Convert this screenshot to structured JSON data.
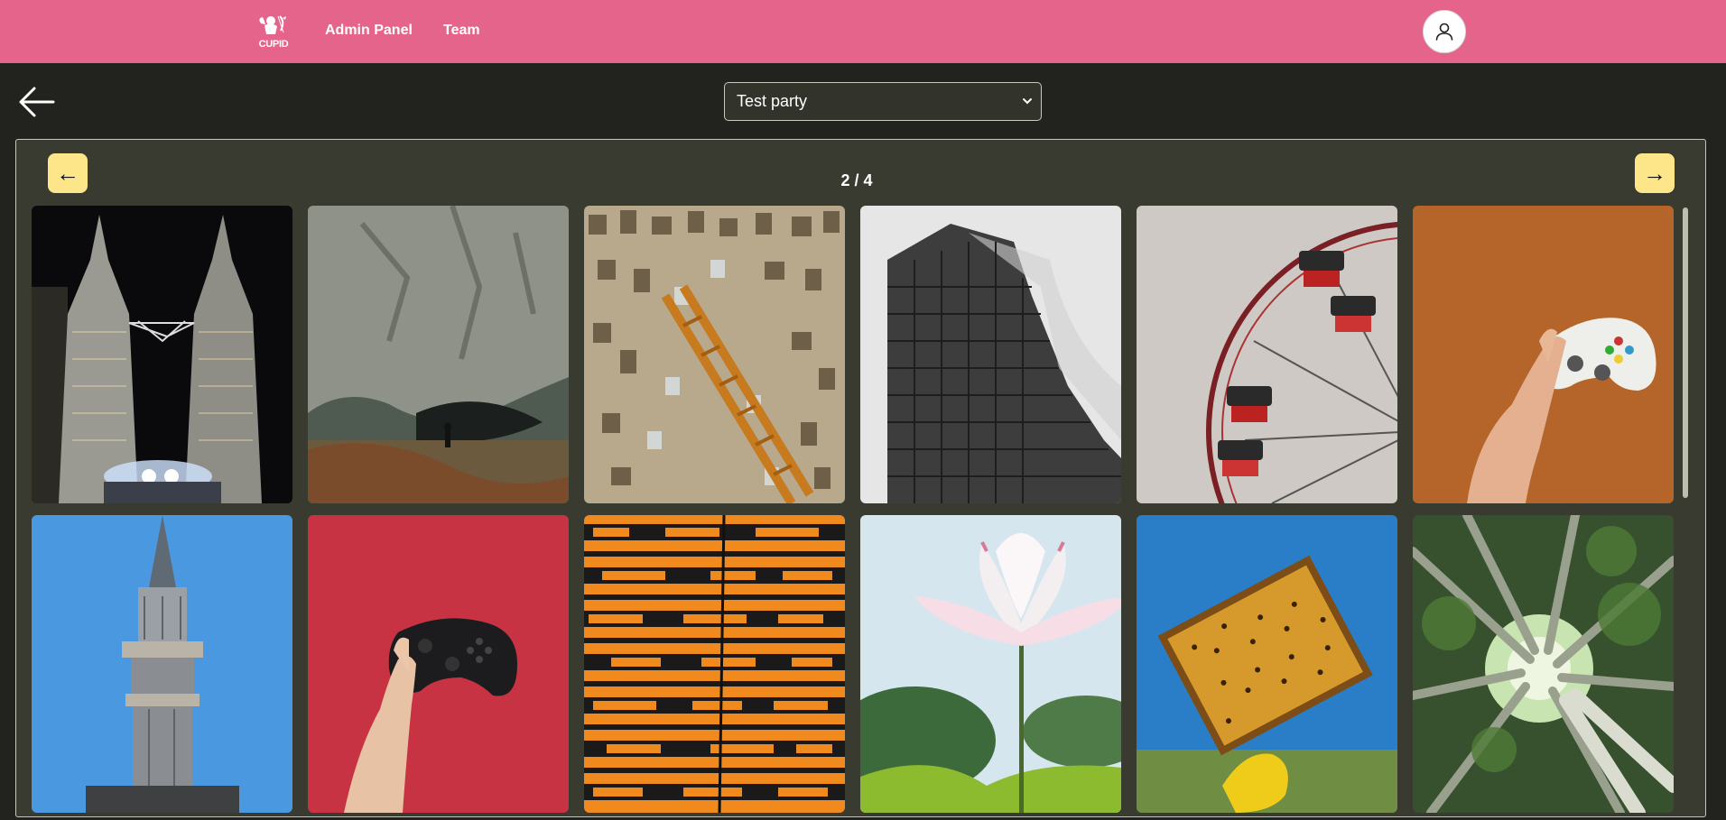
{
  "header": {
    "logo_text": "CUPID",
    "nav": [
      {
        "label": "Admin Panel"
      },
      {
        "label": "Team"
      }
    ],
    "icons": {
      "logo": "cupid-logo-icon",
      "avatar": "user-icon"
    },
    "colors": {
      "bar": "#e5648c"
    }
  },
  "toolbar": {
    "back_icon": "arrow-left-icon",
    "party_select": {
      "selected": "Test party"
    }
  },
  "gallery": {
    "page_label": "2 / 4",
    "prev_label": "←",
    "next_label": "→",
    "colors": {
      "pager_button": "#fde68a",
      "panel": "#393b30"
    },
    "images": [
      {
        "subject": "twin-towers-night"
      },
      {
        "subject": "cave-cliff"
      },
      {
        "subject": "book-wall-staircase"
      },
      {
        "subject": "grey-skyscraper"
      },
      {
        "subject": "ferris-wheel"
      },
      {
        "subject": "hand-white-gamepad"
      },
      {
        "subject": "minaret-blue-sky"
      },
      {
        "subject": "hand-black-gamepad-red"
      },
      {
        "subject": "poster-wall"
      },
      {
        "subject": "lotus-flower"
      },
      {
        "subject": "honeycomb-frame"
      },
      {
        "subject": "bamboo-forest"
      }
    ]
  }
}
